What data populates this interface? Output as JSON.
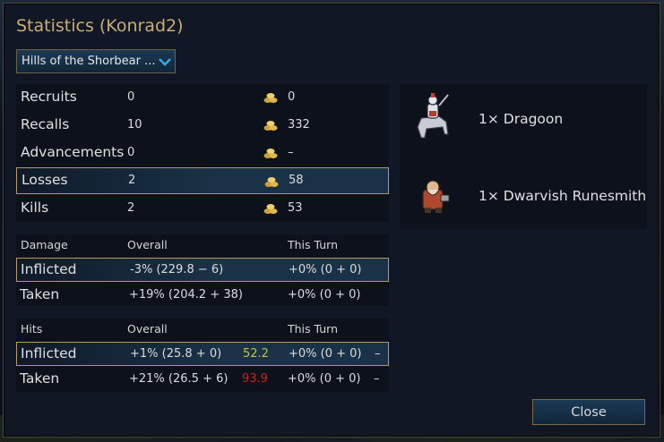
{
  "title": "Statistics (Konrad2)",
  "scenario_dropdown": {
    "value": "Hills of the Shorbear ..."
  },
  "summary": {
    "rows": [
      {
        "label": "Recruits",
        "count": "0",
        "gold": "0"
      },
      {
        "label": "Recalls",
        "count": "10",
        "gold": "332"
      },
      {
        "label": "Advancements",
        "count": "0",
        "gold": "–"
      },
      {
        "label": "Losses",
        "count": "2",
        "gold": "58"
      },
      {
        "label": "Kills",
        "count": "2",
        "gold": "53"
      }
    ]
  },
  "damage": {
    "header": "Damage",
    "col_overall": "Overall",
    "col_turn": "This Turn",
    "inflicted": {
      "label": "Inflicted",
      "overall": "-3% (229.8 − 6)",
      "turn": "+0% (0 + 0)"
    },
    "taken": {
      "label": "Taken",
      "overall": "+19% (204.2 + 38)",
      "turn": "+0% (0 + 0)"
    }
  },
  "hits": {
    "header": "Hits",
    "col_overall": "Overall",
    "col_turn": "This Turn",
    "inflicted": {
      "label": "Inflicted",
      "overall": "+1% (25.8 + 0)",
      "rating": "52.2",
      "turn": "+0% (0 + 0)",
      "turn_rating": "–"
    },
    "taken": {
      "label": "Taken",
      "overall": "+21% (26.5 + 6)",
      "rating": "93.9",
      "turn": "+0% (0 + 0)",
      "turn_rating": "–"
    }
  },
  "units": [
    {
      "label": "1× Dragoon",
      "icon": "dragoon-icon"
    },
    {
      "label": "1× Dwarvish Runesmith",
      "icon": "dwarvish-runesmith-icon"
    }
  ],
  "close_label": "Close",
  "colors": {
    "title": "#c9ad72",
    "highlight_border": "#b89a52",
    "rating_good": "#c8c23a",
    "rating_bad": "#c8251f"
  }
}
